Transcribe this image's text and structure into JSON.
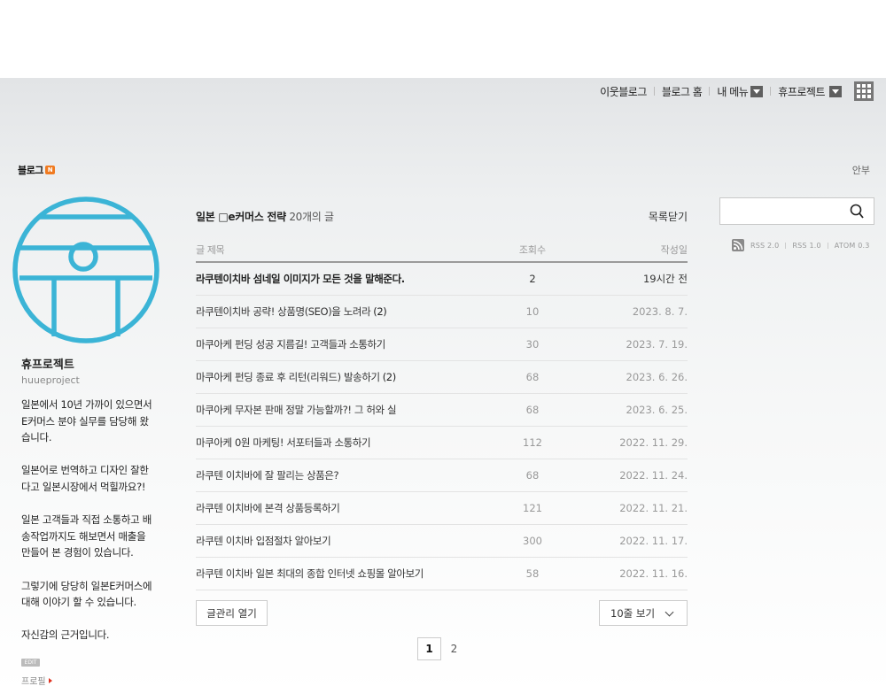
{
  "gnb": {
    "neighbor_blog": "이웃블로그",
    "blog_home": "블로그 홈",
    "my_menu": "내 메뉴",
    "project": "휴프로젝트"
  },
  "logo": {
    "label": "블로그",
    "badge": "N"
  },
  "top_right_link": "안부",
  "profile": {
    "name": "휴프로젝트",
    "id": "huueproject",
    "description": "일본에서 10년 가까이 있으면서 E커머스 분야 실무를 담당해 왔습니다.\n\n일본어로 번역하고 디자인 잘한다고 일본시장에서 먹힐까요?!\n\n일본 고객들과 직접 소통하고 배송작업까지도 해보면서 매출을 만들어 본 경험이 있습니다.\n\n그렇기에 당당히 일본E커머스에 대해 이야기 할 수 있습니다.\n\n자신감의 근거입니다.",
    "edit_badge": "EDIT",
    "profile_link": "프로필"
  },
  "list": {
    "category": "일본 □e커머스 전략",
    "count_text": "20개의 글",
    "close_label": "목록닫기",
    "headers": {
      "title": "글 제목",
      "views": "조회수",
      "date": "작성일"
    },
    "posts": [
      {
        "title": "라쿠텐이치바 섬네일 이미지가 모든 것을 말해준다.",
        "comments": "",
        "views": "2",
        "date": "19시간 전"
      },
      {
        "title": "라쿠텐이치바 공략! 상품명(SEO)을 노려라",
        "comments": "(2)",
        "views": "10",
        "date": "2023. 8. 7."
      },
      {
        "title": "마쿠아케 펀딩 성공 지름길! 고객들과 소통하기",
        "comments": "",
        "views": "30",
        "date": "2023. 7. 19."
      },
      {
        "title": "마쿠아케 펀딩 종료 후 리턴(리워드) 발송하기",
        "comments": "(2)",
        "views": "68",
        "date": "2023. 6. 26."
      },
      {
        "title": "마쿠아케 무자본 판매 정말 가능할까?! 그 허와 실",
        "comments": "",
        "views": "68",
        "date": "2023. 6. 25."
      },
      {
        "title": "마쿠아케 0원 마케팅! 서포터들과 소통하기",
        "comments": "",
        "views": "112",
        "date": "2022. 11. 29."
      },
      {
        "title": "라쿠텐 이치바에 잘 팔리는 상품은?",
        "comments": "",
        "views": "68",
        "date": "2022. 11. 24."
      },
      {
        "title": "라쿠텐 이치바에 본격 상품등록하기",
        "comments": "",
        "views": "121",
        "date": "2022. 11. 21."
      },
      {
        "title": "라쿠텐 이치바 입점절차 알아보기",
        "comments": "",
        "views": "300",
        "date": "2022. 11. 17."
      },
      {
        "title": "라쿠텐 이치바 일본 최대의 종합 인터넷 쇼핑몰 알아보기",
        "comments": "",
        "views": "58",
        "date": "2022. 11. 16."
      }
    ],
    "manage_label": "글관리 열기",
    "rows_label": "10줄 보기"
  },
  "pagination": {
    "pages": [
      "1",
      "2"
    ],
    "current": "1"
  },
  "search": {
    "value": "",
    "placeholder": ""
  },
  "feeds": [
    "RSS 2.0",
    "RSS 1.0",
    "ATOM 0.3"
  ],
  "colors": {
    "profile_icon": "#3bb4d6",
    "accent_badge": "#f07b21"
  },
  "icons": {
    "search": "search-icon",
    "rss": "rss-icon",
    "apps": "apps-grid-icon",
    "profile": "portal-logo-icon"
  }
}
